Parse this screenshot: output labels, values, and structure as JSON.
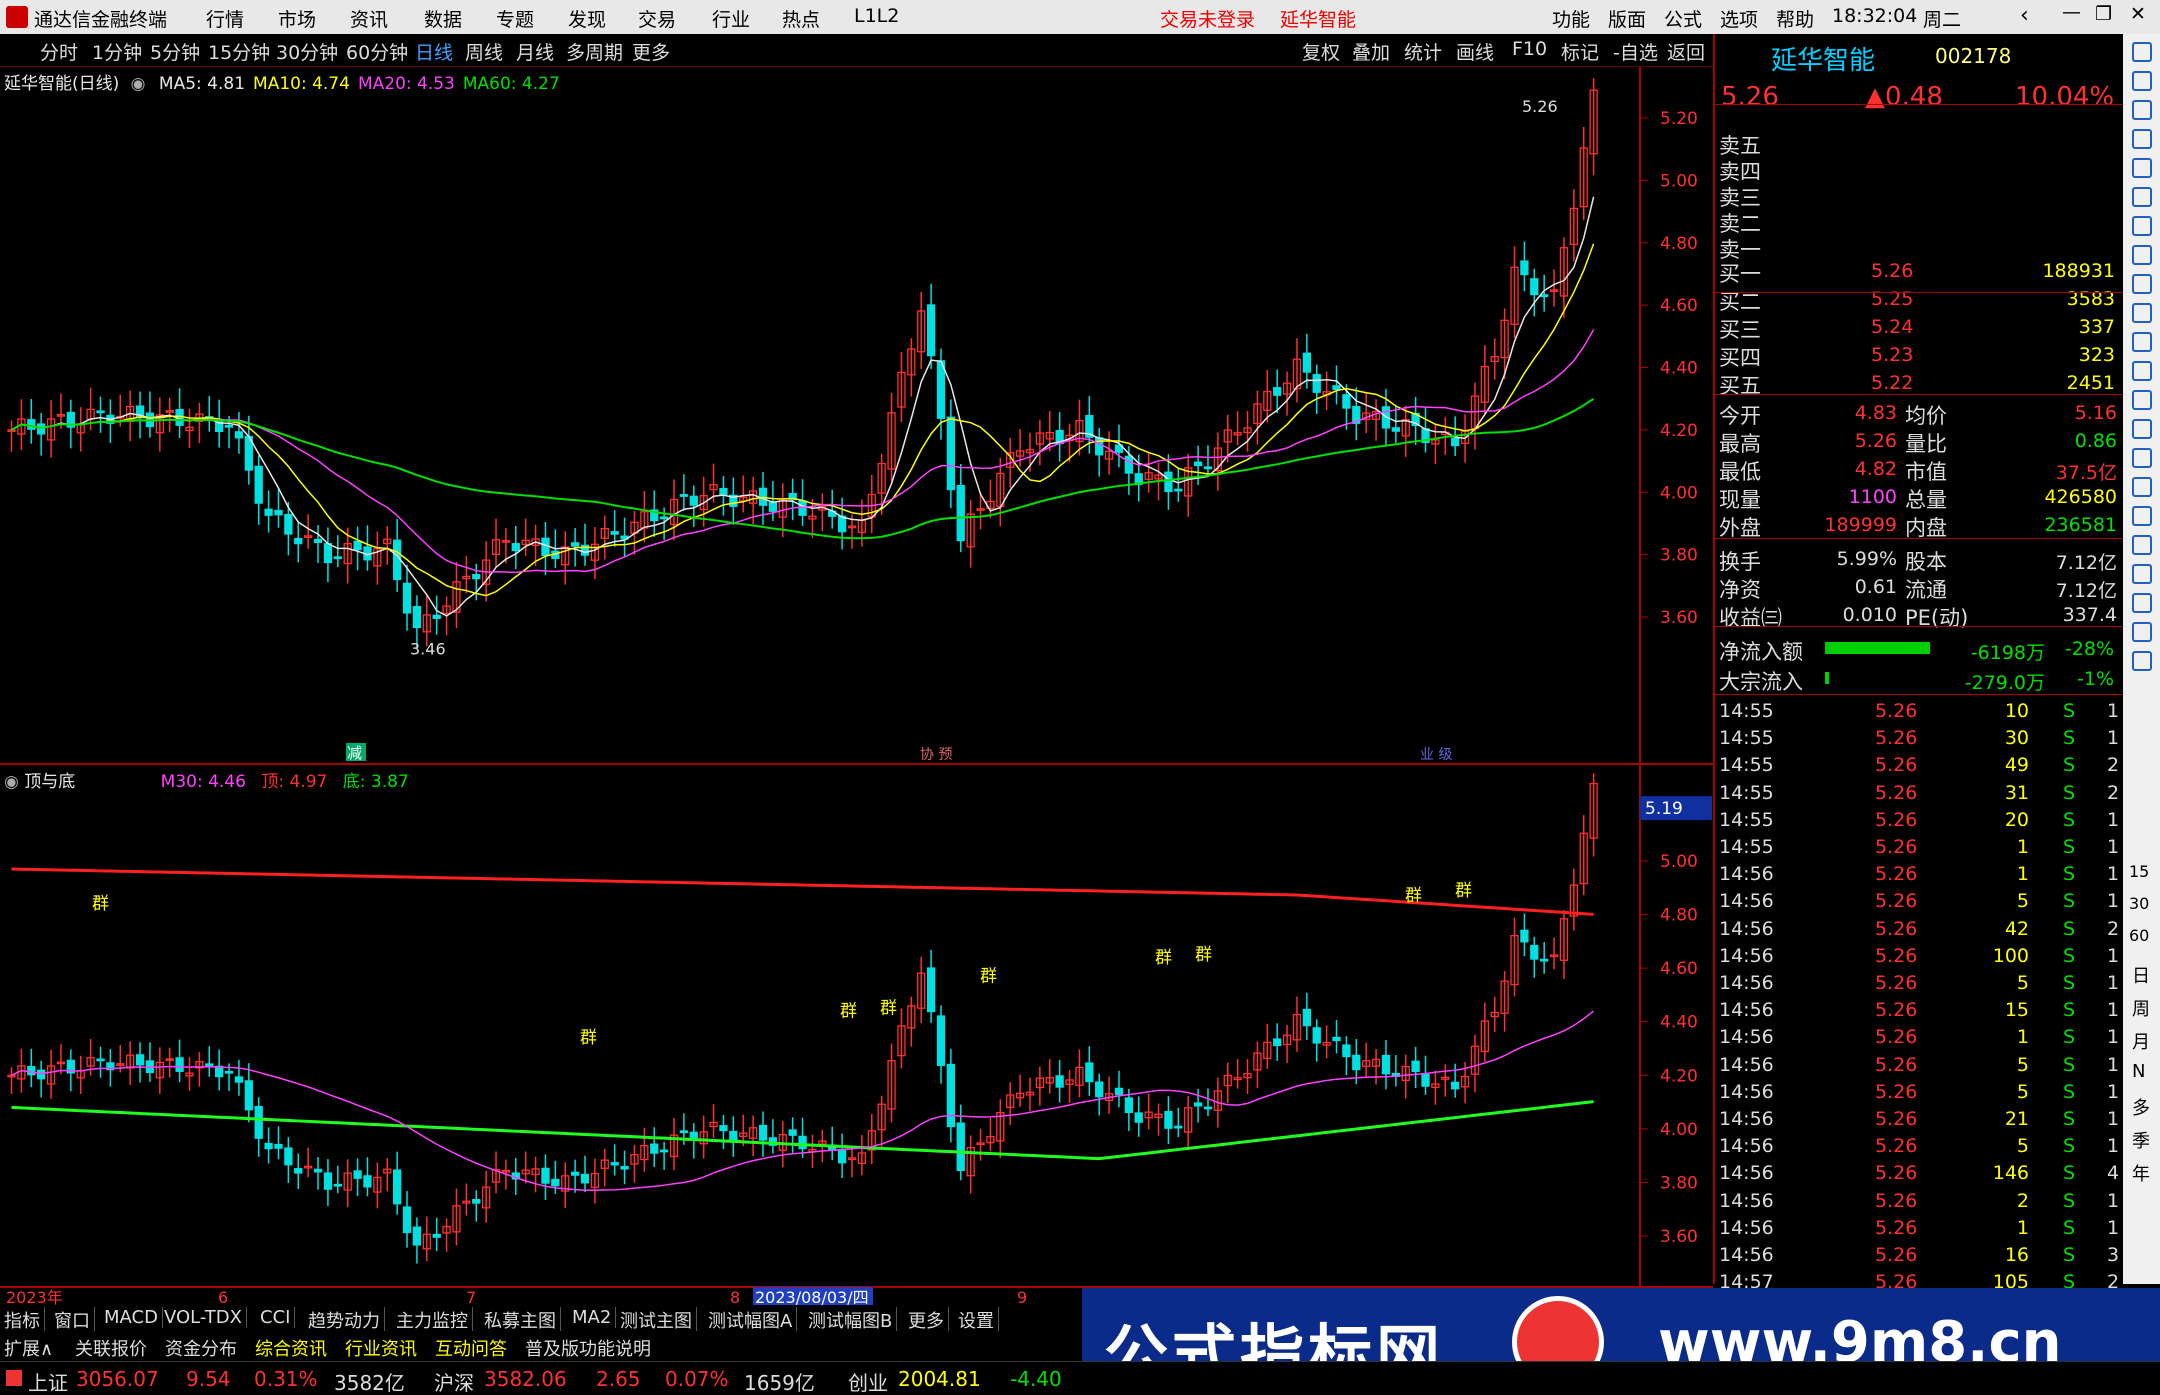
{
  "app": {
    "title": "通达信金融终端",
    "menus": [
      "行情",
      "市场",
      "资讯",
      "数据",
      "专题",
      "发现",
      "交易",
      "行业",
      "热点",
      "L1L2"
    ],
    "login_status": "交易未登录",
    "stock_name": "延华智能",
    "right_menus": [
      "功能",
      "版面",
      "公式",
      "选项",
      "帮助"
    ],
    "time": "18:32:04",
    "weekday": "周二"
  },
  "periods": [
    "分时",
    "1分钟",
    "5分钟",
    "15分钟",
    "30分钟",
    "60分钟",
    "日线",
    "周线",
    "月线",
    "多周期",
    "更多"
  ],
  "tools": [
    "复权",
    "叠加",
    "统计",
    "画线",
    "F10",
    "标记",
    "-自选",
    "返回"
  ],
  "main_chart": {
    "title": "延华智能(日线)",
    "ma": [
      {
        "label": "MA5: 4.81",
        "color": "#e8e8e8"
      },
      {
        "label": "MA10: 4.74",
        "color": "#ffff00"
      },
      {
        "label": "MA20: 4.53",
        "color": "#ff40ff"
      },
      {
        "label": "MA60: 4.27",
        "color": "#00e000"
      }
    ],
    "y_ticks": [
      "5.20",
      "5.00",
      "4.80",
      "4.60",
      "4.40",
      "4.20",
      "4.00",
      "3.80",
      "3.60"
    ],
    "high_label": "5.26",
    "low_label": "3.46",
    "tag1": "减",
    "tag2": "协 预",
    "tag3": "业 级"
  },
  "sub_chart": {
    "title": "顶与底",
    "m30": "M30: 4.46",
    "top": "顶: 4.97",
    "bottom": "底: 3.87",
    "y_ticks": [
      "5.00",
      "4.80",
      "4.60",
      "4.40",
      "4.20",
      "4.00",
      "3.80",
      "3.60"
    ],
    "current": "5.19",
    "marker": "群"
  },
  "x_axis": {
    "labels": [
      "2023年",
      "6",
      "7",
      "8",
      "2023/08/03/四",
      "9"
    ]
  },
  "tabs1": [
    "指标",
    "窗口",
    "MACD",
    "VOL-TDX",
    "CCI",
    "趋势动力",
    "主力监控",
    "私募主图",
    "MA2",
    "测试主图",
    "测试幅图A",
    "测试幅图B",
    "更多",
    "设置"
  ],
  "tabs2": [
    "扩展∧",
    "关联报价",
    "资金分布",
    "综合资讯",
    "行业资讯",
    "互动问答",
    "普及版功能说明"
  ],
  "quote": {
    "name": "延华智能",
    "code": "002178",
    "price": "5.26",
    "change": "▲0.48",
    "pct": "10.04%",
    "sells": [
      "卖五",
      "卖四",
      "卖三",
      "卖二",
      "卖一"
    ],
    "buys": [
      {
        "l": "买一",
        "p": "5.26",
        "v": "188931"
      },
      {
        "l": "买二",
        "p": "5.25",
        "v": "3583"
      },
      {
        "l": "买三",
        "p": "5.24",
        "v": "337"
      },
      {
        "l": "买四",
        "p": "5.23",
        "v": "323"
      },
      {
        "l": "买五",
        "p": "5.22",
        "v": "2451"
      }
    ],
    "stats": [
      {
        "l": "今开",
        "v": "4.83",
        "l2": "均价",
        "v2": "5.16"
      },
      {
        "l": "最高",
        "v": "5.26",
        "l2": "量比",
        "v2": "0.86"
      },
      {
        "l": "最低",
        "v": "4.82",
        "l2": "市值",
        "v2": "37.5亿"
      },
      {
        "l": "现量",
        "v": "1100",
        "l2": "总量",
        "v2": "426580"
      },
      {
        "l": "外盘",
        "v": "189999",
        "l2": "内盘",
        "v2": "236581"
      }
    ],
    "stats2": [
      {
        "l": "换手",
        "v": "5.99%",
        "l2": "股本",
        "v2": "7.12亿"
      },
      {
        "l": "净资",
        "v": "0.61",
        "l2": "流通",
        "v2": "7.12亿"
      },
      {
        "l": "收益㈢",
        "v": "0.010",
        "l2": "PE(动)",
        "v2": "337.4"
      }
    ],
    "flow": [
      {
        "l": "净流入额",
        "v": "-6198万",
        "p": "-28%"
      },
      {
        "l": "大宗流入",
        "v": "-279.0万",
        "p": "-1%"
      }
    ],
    "ticks": [
      [
        "14:55",
        "5.26",
        "10",
        "S",
        "1"
      ],
      [
        "14:55",
        "5.26",
        "30",
        "S",
        "1"
      ],
      [
        "14:55",
        "5.26",
        "49",
        "S",
        "2"
      ],
      [
        "14:55",
        "5.26",
        "31",
        "S",
        "2"
      ],
      [
        "14:55",
        "5.26",
        "20",
        "S",
        "1"
      ],
      [
        "14:55",
        "5.26",
        "1",
        "S",
        "1"
      ],
      [
        "14:56",
        "5.26",
        "1",
        "S",
        "1"
      ],
      [
        "14:56",
        "5.26",
        "5",
        "S",
        "1"
      ],
      [
        "14:56",
        "5.26",
        "42",
        "S",
        "2"
      ],
      [
        "14:56",
        "5.26",
        "100",
        "S",
        "1"
      ],
      [
        "14:56",
        "5.26",
        "5",
        "S",
        "1"
      ],
      [
        "14:56",
        "5.26",
        "15",
        "S",
        "1"
      ],
      [
        "14:56",
        "5.26",
        "1",
        "S",
        "1"
      ],
      [
        "14:56",
        "5.26",
        "5",
        "S",
        "1"
      ],
      [
        "14:56",
        "5.26",
        "5",
        "S",
        "1"
      ],
      [
        "14:56",
        "5.26",
        "21",
        "S",
        "1"
      ],
      [
        "14:56",
        "5.26",
        "5",
        "S",
        "1"
      ],
      [
        "14:56",
        "5.26",
        "146",
        "S",
        "4"
      ],
      [
        "14:56",
        "5.26",
        "2",
        "S",
        "1"
      ],
      [
        "14:56",
        "5.26",
        "1",
        "S",
        "1"
      ],
      [
        "14:56",
        "5.26",
        "16",
        "S",
        "3"
      ],
      [
        "14:57",
        "5.26",
        "105",
        "S",
        "2"
      ]
    ]
  },
  "side_icons": [
    "日",
    "周",
    "月",
    "N",
    "多",
    "季",
    "年"
  ],
  "side_nums": [
    "15",
    "30",
    "60"
  ],
  "status": {
    "items": [
      {
        "n": "上证",
        "v": "3056.07",
        "c": "9.54",
        "p": "0.31%",
        "a": "3582亿"
      },
      {
        "n": "沪深",
        "v": "3582.06",
        "c": "2.65",
        "p": "0.07%",
        "a": "1659亿"
      },
      {
        "n": "创业",
        "v": "2004.81",
        "c": "-4.40"
      }
    ]
  },
  "banner": {
    "text": "公式指标网",
    "url": "www.9m8.cn"
  },
  "colors": {
    "up": "#ff3030",
    "down": "#00e0e0",
    "ma5": "#e8e8e8",
    "ma10": "#ffff00",
    "ma20": "#ff40ff",
    "ma60": "#00e000"
  }
}
